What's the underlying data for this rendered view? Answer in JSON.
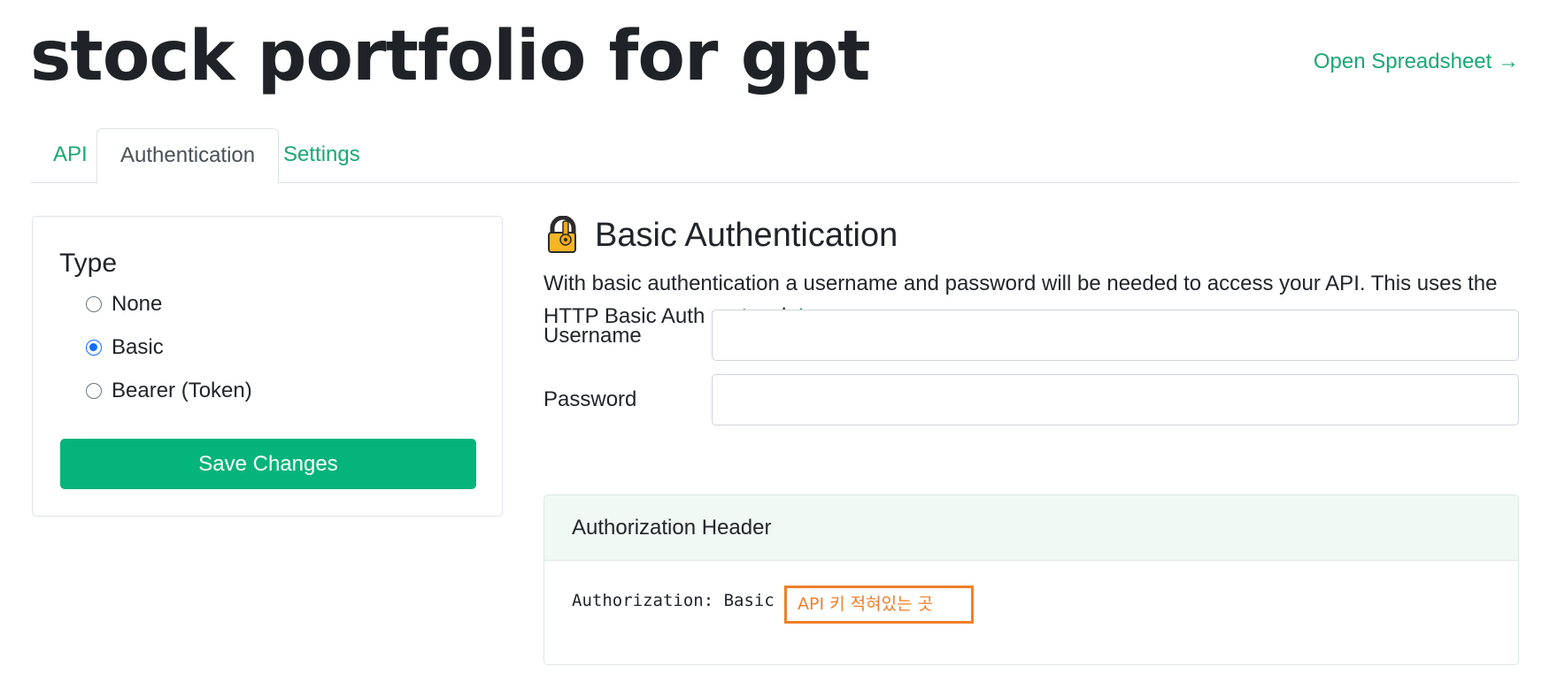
{
  "header": {
    "title": "stock portfolio for gpt",
    "open_spreadsheet": "Open Spreadsheet →"
  },
  "tabs": [
    {
      "label": "API",
      "active": false
    },
    {
      "label": "Authentication",
      "active": true
    },
    {
      "label": "Settings",
      "active": false
    }
  ],
  "type_panel": {
    "heading": "Type",
    "options": [
      {
        "label": "None",
        "checked": false
      },
      {
        "label": "Basic",
        "checked": true
      },
      {
        "label": "Bearer (Token)",
        "checked": false
      }
    ],
    "save_label": "Save Changes"
  },
  "basic_auth": {
    "heading": "Basic Authentication",
    "icon": "lock-with-key-icon",
    "description": "With basic authentication a username and password will be needed to access your API. This uses the HTTP Basic Auth protocol.",
    "learn_more": "Learn more →",
    "username_label": "Username",
    "username_value": "",
    "password_label": "Password",
    "password_value": ""
  },
  "auth_header": {
    "title": "Authorization Header",
    "code": "Authorization: Basic",
    "api_key_note": "API 키 적혀있는 곳"
  },
  "colors": {
    "accent": "#1aa873",
    "button": "#05b47a",
    "highlight": "#f07f2a",
    "radio_checked": "#0d6efd"
  }
}
